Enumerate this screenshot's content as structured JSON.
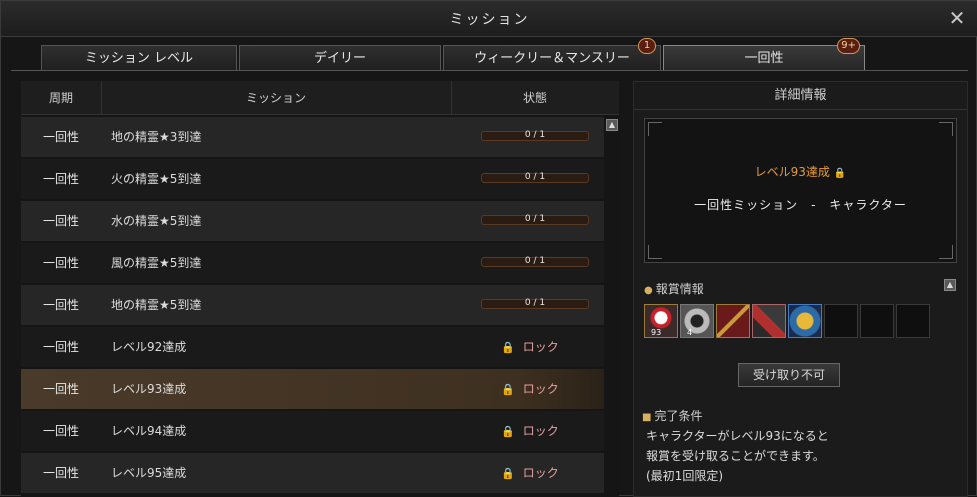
{
  "window": {
    "title": "ミッション",
    "close": "✕"
  },
  "tabs": [
    {
      "label": "ミッション レベル",
      "badge": ""
    },
    {
      "label": "デイリー",
      "badge": ""
    },
    {
      "label": "ウィークリー＆マンスリー",
      "badge": "1"
    },
    {
      "label": "一回性",
      "badge": "9+"
    }
  ],
  "table": {
    "headers": [
      "周期",
      "ミッション",
      "状態"
    ],
    "rows": [
      {
        "period": "一回性",
        "mission": "地の精霊★3到達",
        "status_type": "progress",
        "progress": "0 / 1",
        "progress_fraction": 0
      },
      {
        "period": "一回性",
        "mission": "火の精霊★5到達",
        "status_type": "progress",
        "progress": "0 / 1",
        "progress_fraction": 0
      },
      {
        "period": "一回性",
        "mission": "水の精霊★5到達",
        "status_type": "progress",
        "progress": "0 / 1",
        "progress_fraction": 0
      },
      {
        "period": "一回性",
        "mission": "風の精霊★5到達",
        "status_type": "progress",
        "progress": "0 / 1",
        "progress_fraction": 0
      },
      {
        "period": "一回性",
        "mission": "地の精霊★5到達",
        "status_type": "progress",
        "progress": "0 / 1",
        "progress_fraction": 0
      },
      {
        "period": "一回性",
        "mission": "レベル92達成",
        "status_type": "locked",
        "status": "ロック"
      },
      {
        "period": "一回性",
        "mission": "レベル93達成",
        "status_type": "locked",
        "status": "ロック",
        "selected": true
      },
      {
        "period": "一回性",
        "mission": "レベル94達成",
        "status_type": "locked",
        "status": "ロック"
      },
      {
        "period": "一回性",
        "mission": "レベル95達成",
        "status_type": "locked",
        "status": "ロック"
      }
    ]
  },
  "detail": {
    "header": "詳細情報",
    "level_text": "レベル93達成",
    "name": "一回性ミッション　-　キャラクター",
    "rewards_label": "報賞情報",
    "rewards": [
      {
        "icon": "gift-box-icon",
        "qty": "93"
      },
      {
        "icon": "equipment-box-icon",
        "qty": "4"
      },
      {
        "icon": "spellbook-icon",
        "qty": ""
      },
      {
        "icon": "crafting-material-icon",
        "qty": ""
      },
      {
        "icon": "gold-medal-icon",
        "qty": ""
      },
      {
        "icon": "empty-slot",
        "qty": ""
      },
      {
        "icon": "empty-slot",
        "qty": ""
      },
      {
        "icon": "empty-slot",
        "qty": ""
      }
    ],
    "claim_button": "受け取り不可",
    "condition_label": "完了条件",
    "condition_lines": [
      "キャラクターがレベル93になると",
      "報賞を受け取ることができます。",
      "(最初1回限定)"
    ]
  },
  "colors": {
    "accent_orange": "#e49b3c",
    "lock_red": "#d06070",
    "selected_row": "#4a3a2a"
  }
}
